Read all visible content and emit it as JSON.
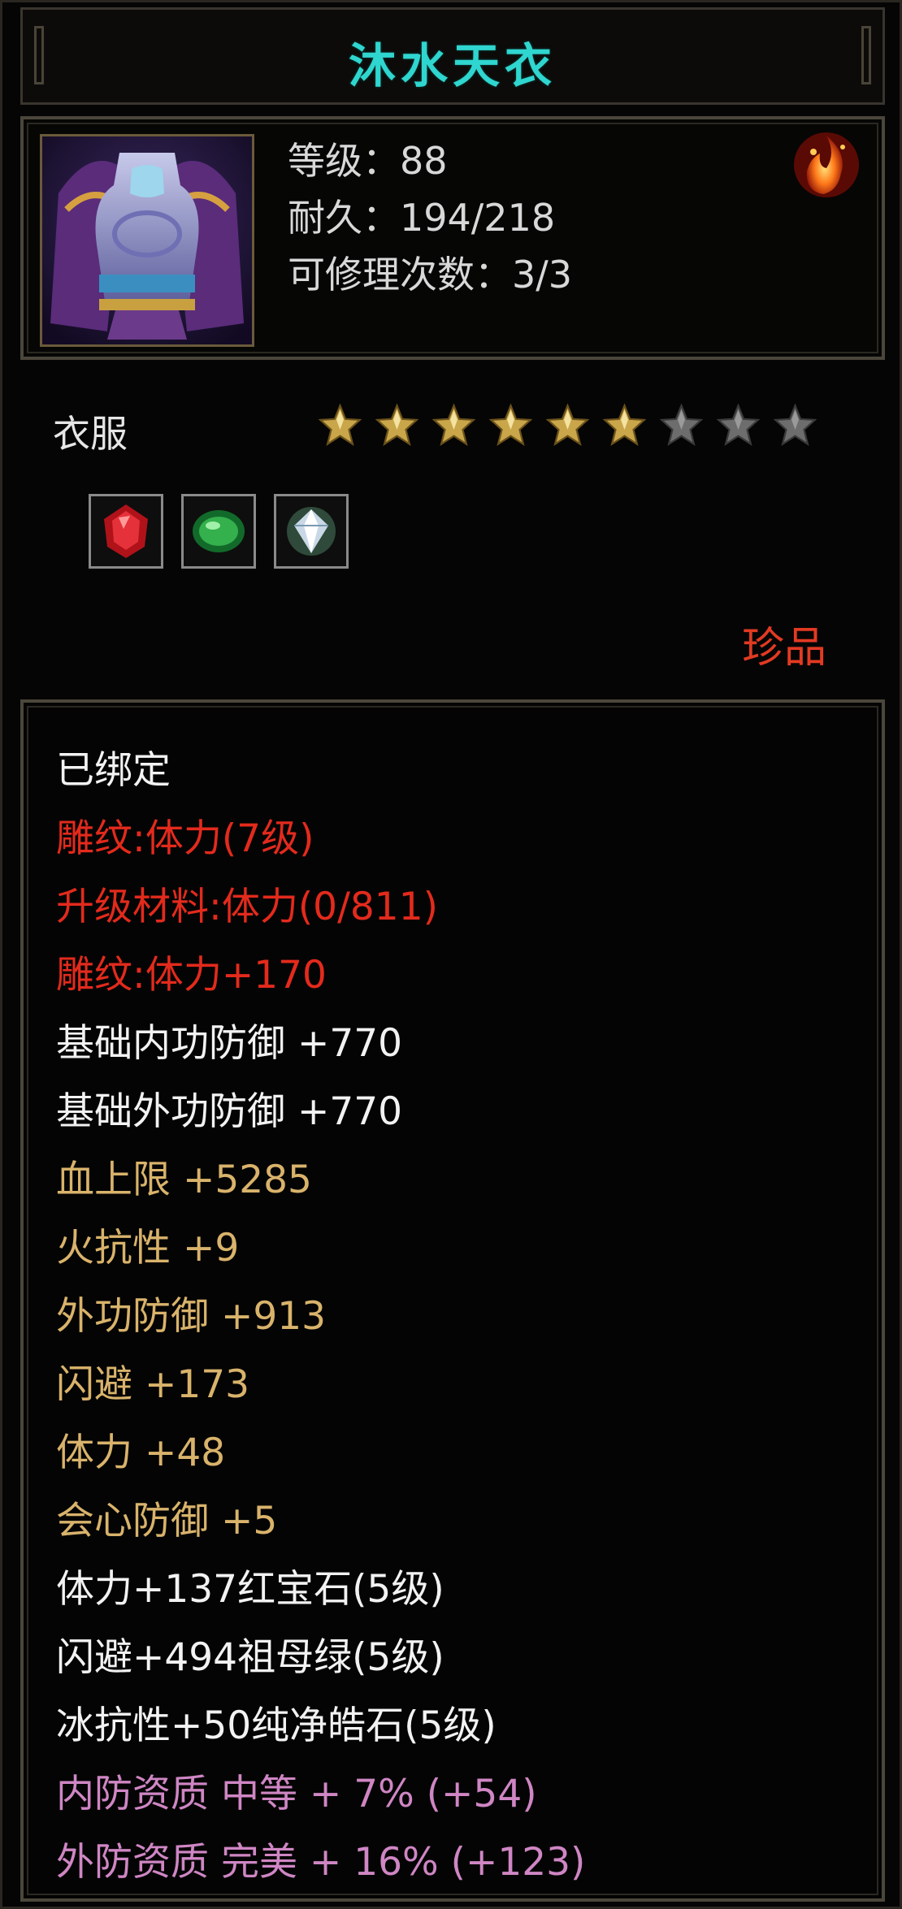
{
  "item": {
    "name": "沐水天衣",
    "level_line": "等级：88",
    "durability_line": "耐久：194/218",
    "repair_line": "可修理次数：3/3",
    "subtype": "衣服",
    "rarity": "珍品",
    "stars_filled": 6,
    "stars_total": 9,
    "gem_icons": [
      "ruby-gem-icon",
      "emerald-gem-icon",
      "diamond-gem-icon"
    ],
    "attributes": [
      {
        "text": "已绑定",
        "color": "white"
      },
      {
        "text": "雕纹:体力(7级)",
        "color": "red"
      },
      {
        "text": "升级材料:体力(0/811)",
        "color": "red"
      },
      {
        "text": "雕纹:体力+170",
        "color": "red"
      },
      {
        "text": "基础内功防御 +770",
        "color": "white"
      },
      {
        "text": "基础外功防御 +770",
        "color": "white"
      },
      {
        "text": "血上限 +5285",
        "color": "gold"
      },
      {
        "text": "火抗性 +9",
        "color": "gold"
      },
      {
        "text": "外功防御 +913",
        "color": "gold"
      },
      {
        "text": "闪避 +173",
        "color": "gold"
      },
      {
        "text": "体力 +48",
        "color": "gold"
      },
      {
        "text": "会心防御 +5",
        "color": "gold"
      },
      {
        "text": "体力+137红宝石(5级)",
        "color": "white"
      },
      {
        "text": "闪避+494祖母绿(5级)",
        "color": "white"
      },
      {
        "text": "冰抗性+50纯净皓石(5级)",
        "color": "white"
      },
      {
        "text": "内防资质 中等 + 7% (+54)",
        "color": "pink"
      },
      {
        "text": "外防资质 完美 + 16% (+123)",
        "color": "pink"
      }
    ]
  },
  "colors": {
    "title": "#2fd6cf",
    "rarity": "#e23a22",
    "star_filled": "#c9a64a",
    "star_empty": "#6d6d6d",
    "red_text": "#e32a1c",
    "gold_text": "#d9b36b",
    "pink_text": "#cf86c4"
  }
}
